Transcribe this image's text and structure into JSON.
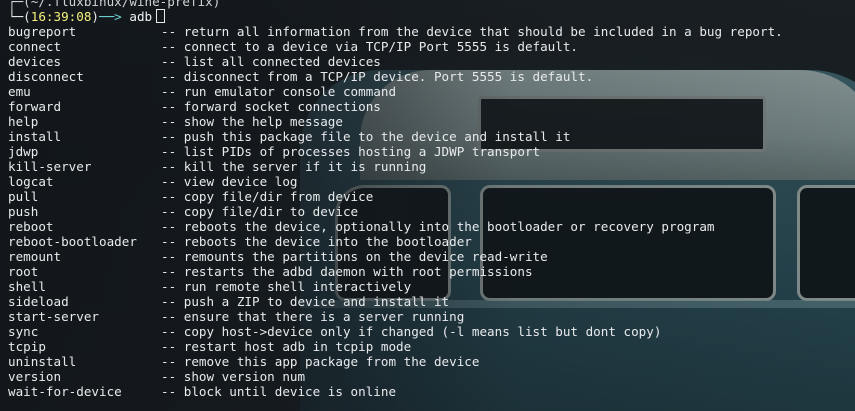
{
  "prompt": {
    "path": "(~/.fluxbinux/wine-prefix)",
    "time": "16:39:08",
    "command": "adb"
  },
  "commands": [
    {
      "name": "bugreport",
      "desc": "-- return all information from the device that should be included in a bug report."
    },
    {
      "name": "connect",
      "desc": "-- connect to a device via TCP/IP Port 5555 is default."
    },
    {
      "name": "devices",
      "desc": "-- list all connected devices"
    },
    {
      "name": "disconnect",
      "desc": "-- disconnect from a TCP/IP device. Port 5555 is default."
    },
    {
      "name": "emu",
      "desc": "-- run emulator console command"
    },
    {
      "name": "forward",
      "desc": "-- forward socket connections"
    },
    {
      "name": "help",
      "desc": "-- show the help message"
    },
    {
      "name": "install",
      "desc": "-- push this package file to the device and install it"
    },
    {
      "name": "jdwp",
      "desc": "-- list PIDs of processes hosting a JDWP transport"
    },
    {
      "name": "kill-server",
      "desc": "-- kill the server if it is running"
    },
    {
      "name": "logcat",
      "desc": "-- view device log"
    },
    {
      "name": "pull",
      "desc": "-- copy file/dir from device"
    },
    {
      "name": "push",
      "desc": "-- copy file/dir to device"
    },
    {
      "name": "reboot",
      "desc": "-- reboots the device, optionally into the bootloader or recovery program"
    },
    {
      "name": "reboot-bootloader",
      "desc": "-- reboots the device into the bootloader"
    },
    {
      "name": "remount",
      "desc": "-- remounts the partitions on the device read-write"
    },
    {
      "name": "root",
      "desc": "-- restarts the adbd daemon with root permissions"
    },
    {
      "name": "shell",
      "desc": "-- run remote shell interactively"
    },
    {
      "name": "sideload",
      "desc": "-- push a ZIP to device and install it"
    },
    {
      "name": "start-server",
      "desc": "-- ensure that there is a server running"
    },
    {
      "name": "sync",
      "desc": "-- copy host->device only if changed (-l means list but dont copy)"
    },
    {
      "name": "tcpip",
      "desc": "-- restart host adb in tcpip mode"
    },
    {
      "name": "uninstall",
      "desc": "-- remove this app package from the device"
    },
    {
      "name": "version",
      "desc": "-- show version num"
    },
    {
      "name": "wait-for-device",
      "desc": "-- block until device is online"
    }
  ]
}
